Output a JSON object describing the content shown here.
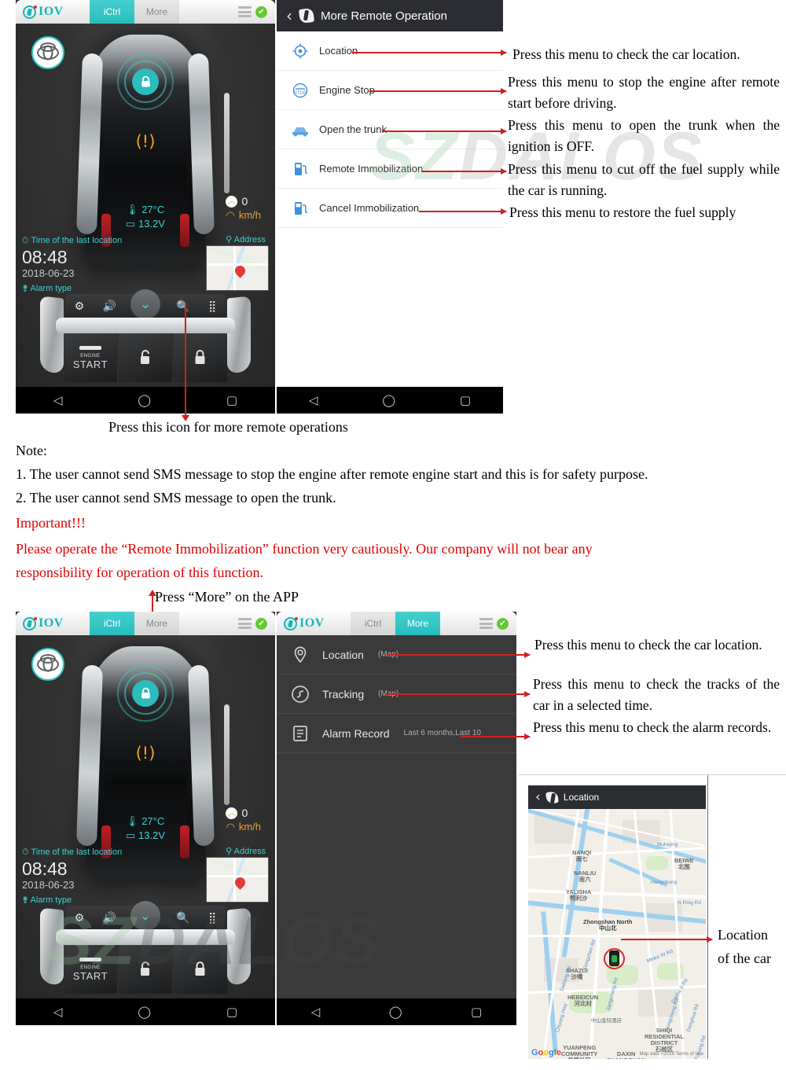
{
  "app": {
    "brand": "IOV",
    "tabs": [
      {
        "label": "iCtrl",
        "active": true
      },
      {
        "label": "More",
        "active": false
      }
    ],
    "tabs_lower": [
      {
        "label": "iCtrl",
        "active": false
      },
      {
        "label": "More",
        "active": true
      }
    ],
    "icons": {
      "list": "list-icon",
      "check": "check-badge-icon"
    }
  },
  "dashboard": {
    "temperature": "27°C",
    "voltage": "13.2V",
    "speed_value": "0",
    "speed_unit": "km/h",
    "last_location_label": "Time of the last location",
    "time": "08:48",
    "date": "2018-06-23",
    "alarm_type_label": "Alarm type",
    "address_label": "Address",
    "engine_button_small": "ENGINE",
    "engine_button_large": "START",
    "console_icons": [
      "gear-icon",
      "speaker-icon",
      "chevron-down-icon",
      "camera-search-icon",
      "grid-apps-icon"
    ],
    "lock_icon": "lock-icon",
    "warning_icon": "tire-pressure-warning-icon",
    "vehicle_badge": "toyota-logo-icon"
  },
  "navbar": {
    "back": "◁",
    "home": "◯",
    "recent": "▢"
  },
  "remote_panel": {
    "title": "More Remote Operation",
    "items": [
      {
        "label": "Location",
        "icon": "crosshair-location-icon"
      },
      {
        "label": "Engine Stop",
        "icon": "stop-sign-icon"
      },
      {
        "label": "Open the trunk",
        "icon": "car-icon"
      },
      {
        "label": "Remote Immobilization",
        "icon": "fuel-pump-icon"
      },
      {
        "label": "Cancel Immobilization",
        "icon": "fuel-pump-icon"
      }
    ],
    "descriptions": [
      "Press this menu to check the car location.",
      "Press this menu to stop the engine after remote start before driving.",
      "Press this menu to open the trunk when the ignition is OFF.",
      "Press this menu to cut off the fuel supply while the car is running.",
      "Press this menu to restore the fuel supply"
    ]
  },
  "more_panel": {
    "items": [
      {
        "label": "Location",
        "sub": "(Map)",
        "icon": "map-pin-icon"
      },
      {
        "label": "Tracking",
        "sub": "(Map)",
        "icon": "tracking-icon"
      },
      {
        "label": "Alarm Record",
        "sub": "Last 6 months,Last 10",
        "icon": "records-list-icon"
      }
    ],
    "descriptions": [
      "Press this menu to check the car location.",
      "Press this menu to check the tracks of the car in a selected time.",
      "Press this menu to check the alarm records."
    ]
  },
  "location_panel": {
    "title": "Location",
    "annotation_line1": "Location",
    "annotation_line2": "of the car",
    "map_labels": [
      "NANQI",
      "南七",
      "NANLIU",
      "南六",
      "YALISHA",
      "鸭利沙",
      "BEIWE",
      "北围",
      "Muhejing",
      "Hengchong",
      "N Ring Rd",
      "Zhongshan North",
      "中山北",
      "SHAZUI",
      "沙嘴",
      "HEBEICUN",
      "河北村",
      "中山金钰酒店",
      "SHIQI RESIDENTIAL DISTRICT",
      "石岐区",
      "YUANFENG COMMUNITY",
      "员峰社区",
      "DAXIN SHANGQUAN",
      "大信商圈",
      "Dasha S Rd",
      "Minke W Rd",
      "Dongcheng Rd",
      "Donghua Rd",
      "Fukang Rd",
      "Chiyang Hwy",
      "Dabang Rd",
      "Xiongzhen Rd",
      "Jiangcheng Rd"
    ],
    "brand": "Google",
    "attribution": "Map data ©2018   Terms of Use"
  },
  "annotations": {
    "press_icon": "Press this icon for more remote operations",
    "press_more": "Press “More” on the APP"
  },
  "notes": {
    "heading": "Note:",
    "items": [
      "1. The user cannot send SMS message to stop the engine after remote engine start and this is for safety purpose.",
      "2.  The user cannot send SMS message to open the trunk."
    ],
    "important_heading": "Important!!!",
    "important_body_line1": "Please operate the “Remote Immobilization” function very cautiously. Our company will not bear any",
    "important_body_line2": "responsibility for operation of this function."
  },
  "watermark": {
    "text_green": "SZ",
    "text_gray": "DALOS"
  },
  "colors": {
    "teal": "#2bbcbc",
    "red_arrow": "#d02020",
    "important_red": "#e00000",
    "dark_header": "#2b2d33",
    "green_check": "#64c832"
  }
}
